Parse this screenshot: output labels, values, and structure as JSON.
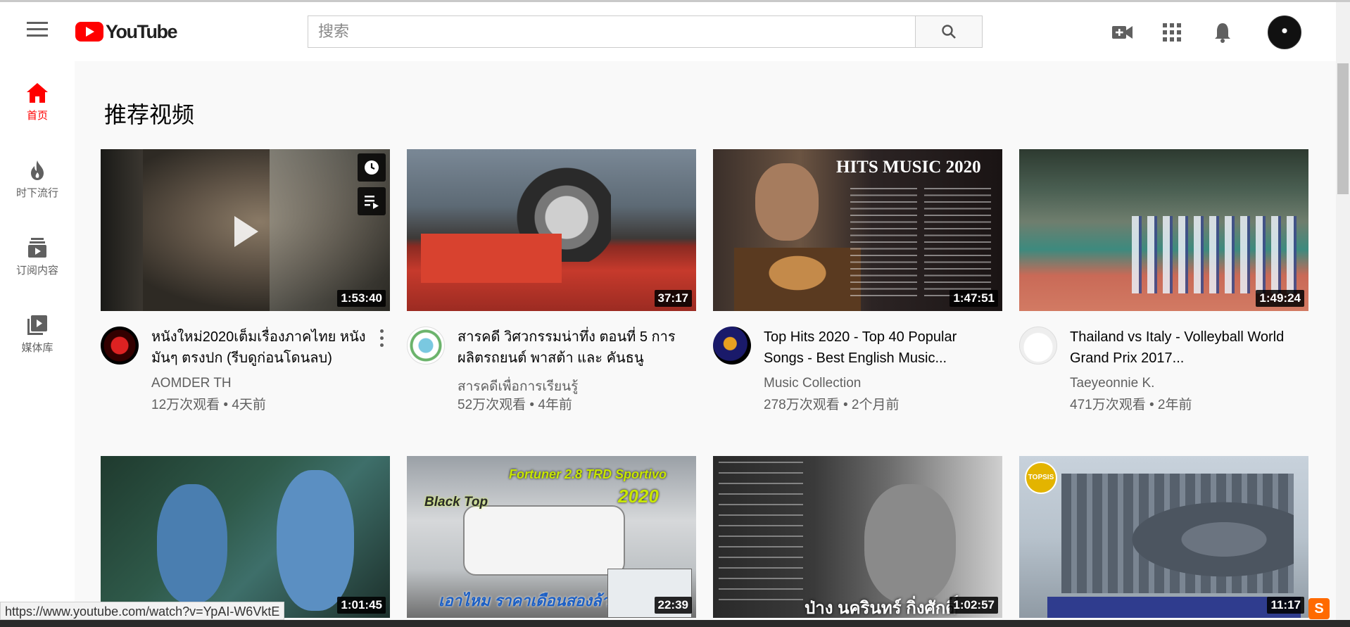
{
  "header": {
    "logo_text": "YouTube",
    "search_placeholder": "搜索"
  },
  "sidebar": {
    "items": [
      {
        "label": "首页",
        "icon": "home-icon",
        "active": true
      },
      {
        "label": "时下流行",
        "icon": "flame-icon",
        "active": false
      },
      {
        "label": "订阅内容",
        "icon": "subscriptions-icon",
        "active": false
      },
      {
        "label": "媒体库",
        "icon": "library-icon",
        "active": false
      }
    ]
  },
  "main": {
    "shelf_title": "推荐视频",
    "videos": [
      {
        "title": "หนังใหม่2020เต็มเรื่องภาคไทย หนังมันๆ ตรงปก (รีบดูก่อนโดนลบ)",
        "channel": "AOMDER TH",
        "stats": "12万次观看 • 4天前",
        "duration": "1:53:40"
      },
      {
        "title": "สารคดี วิศวกรรมน่าทึ่ง ตอนที่ 5 การผลิตรถยนต์ พาสต้า และ คันธนู",
        "channel": "สารคดีเพื่อการเรียนรู้",
        "stats": "52万次观看 • 4年前",
        "duration": "37:17"
      },
      {
        "title": "Top Hits 2020 - Top 40 Popular Songs - Best English Music...",
        "channel": "Music Collection",
        "stats": "278万次观看 • 2个月前",
        "duration": "1:47:51"
      },
      {
        "title": "Thailand vs Italy - Volleyball World Grand Prix 2017...",
        "channel": "Taeyeonnie K.",
        "stats": "471万次观看 • 2年前",
        "duration": "1:49:24"
      },
      {
        "duration": "1:01:45"
      },
      {
        "duration": "22:39"
      },
      {
        "duration": "1:02:57"
      },
      {
        "duration": "11:17"
      }
    ]
  },
  "thumb_text": {
    "hits_title": "HITS MUSIC 2020",
    "fortuner_line1": "Fortuner 2.8 TRD Sportivo",
    "fortuner_year": "2020",
    "fortuner_black": "Black Top",
    "fortuner_thai": "เอาไหม ราคาเดือนสองล้าน",
    "singer_caption": "ป่าง นครินทร์ กิ่งศักดิ์",
    "topsis_logo": "TOPSIS"
  },
  "status_bar": {
    "url": "https://www.youtube.com/watch?v=YpAI-W6VktE"
  },
  "colors": {
    "brand_red": "#ff0000",
    "text_secondary": "#606060",
    "page_bg": "#f9f9f9"
  }
}
